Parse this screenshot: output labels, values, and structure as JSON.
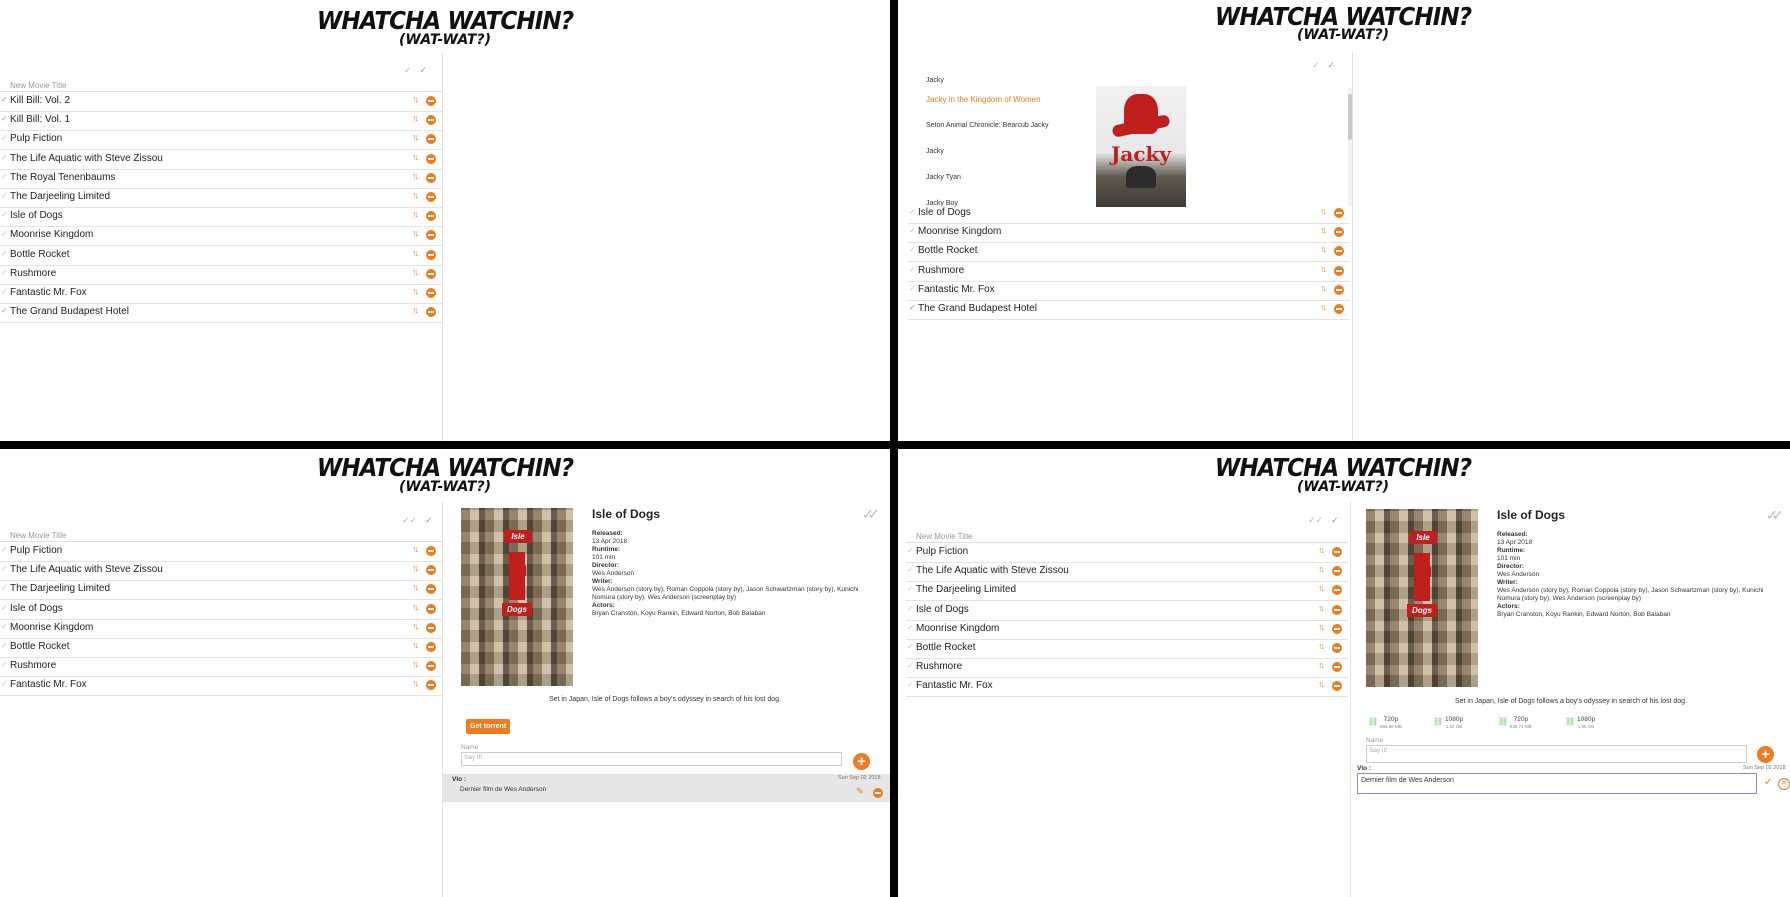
{
  "app": {
    "title": "WHATCHA WATCHIN?",
    "subtitle": "(WAT-WAT?)"
  },
  "icons": {
    "check": "✓",
    "sort": "↑↓",
    "remove": "−",
    "plus": "+",
    "pencil": "✎",
    "link": "⛓",
    "close": "✕",
    "double_check": "✓✓"
  },
  "colors": {
    "accent": "#f07a1e",
    "watched": "#63c35f"
  },
  "new_movie_placeholder": "New Movie Title",
  "q1": {
    "movies": [
      {
        "title": "Kill Bill: Vol. 2",
        "watched": true
      },
      {
        "title": "Kill Bill: Vol. 1",
        "watched": true
      },
      {
        "title": "Pulp Fiction",
        "watched": false
      },
      {
        "title": "The Life Aquatic with Steve Zissou",
        "watched": false
      },
      {
        "title": "The Royal Tenenbaums",
        "watched": false
      },
      {
        "title": "The Darjeeling Limited",
        "watched": false
      },
      {
        "title": "Isle of Dogs",
        "watched": false
      },
      {
        "title": "Moonrise Kingdom",
        "watched": false
      },
      {
        "title": "Bottle Rocket",
        "watched": false
      },
      {
        "title": "Rushmore",
        "watched": false
      },
      {
        "title": "Fantastic Mr. Fox",
        "watched": false
      },
      {
        "title": "The Grand Budapest Hotel",
        "watched": true
      }
    ]
  },
  "q2": {
    "suggestions": [
      "Jacky",
      "Jacky in the Kingdom of Women",
      "Seton Animal Chronicle: Bearcub Jacky",
      "Jacky",
      "Jacky Tyan",
      "Jacky Boy"
    ],
    "active_suggestion": 1,
    "poster_text": "Jacky",
    "movies": [
      {
        "title": "Isle of Dogs",
        "watched": false
      },
      {
        "title": "Moonrise Kingdom",
        "watched": false
      },
      {
        "title": "Bottle Rocket",
        "watched": false
      },
      {
        "title": "Rushmore",
        "watched": false
      },
      {
        "title": "Fantastic Mr. Fox",
        "watched": false
      },
      {
        "title": "The Grand Budapest Hotel",
        "watched": true
      }
    ]
  },
  "detail_list": [
    {
      "title": "Pulp Fiction",
      "watched": false
    },
    {
      "title": "The Life Aquatic with Steve Zissou",
      "watched": false
    },
    {
      "title": "The Darjeeling Limited",
      "watched": false
    },
    {
      "title": "Isle of Dogs",
      "watched": false
    },
    {
      "title": "Moonrise Kingdom",
      "watched": false
    },
    {
      "title": "Bottle Rocket",
      "watched": false
    },
    {
      "title": "Rushmore",
      "watched": false
    },
    {
      "title": "Fantastic Mr. Fox",
      "watched": false
    }
  ],
  "movie": {
    "title": "Isle of Dogs",
    "poster_words": [
      "Isle",
      "of",
      "Dogs"
    ],
    "released_label": "Released:",
    "released": "13 Apr 2018",
    "runtime_label": "Runtime:",
    "runtime": "101 min",
    "director_label": "Director:",
    "director": "Wes Anderson",
    "writer_label": "Writer:",
    "writer": "Wes Anderson (story by), Roman Coppola (story by), Jason Schwartzman (story by), Kunichi Nomura (story by), Wes Anderson (screenplay by)",
    "actors_label": "Actors:",
    "actors": "Bryan Cranston, Koyu Rankin, Edward Norton, Bob Balaban",
    "plot": "Set in Japan, Isle of Dogs follows a boy's odyssey in search of his lost dog."
  },
  "torrent_button": "Get torrent",
  "torrents": [
    {
      "quality": "720p",
      "size": "866.98 MB"
    },
    {
      "quality": "1080p",
      "size": "1.62 GB"
    },
    {
      "quality": "720p",
      "size": "835.71 MB"
    },
    {
      "quality": "1080p",
      "size": "1.55 GB"
    }
  ],
  "comment_form": {
    "name_label": "Name",
    "placeholder": "Say it!"
  },
  "comment": {
    "user": "Vlo :",
    "date": "Sun Sep 02 2018",
    "text": "Dernier film de Wes Anderson"
  }
}
